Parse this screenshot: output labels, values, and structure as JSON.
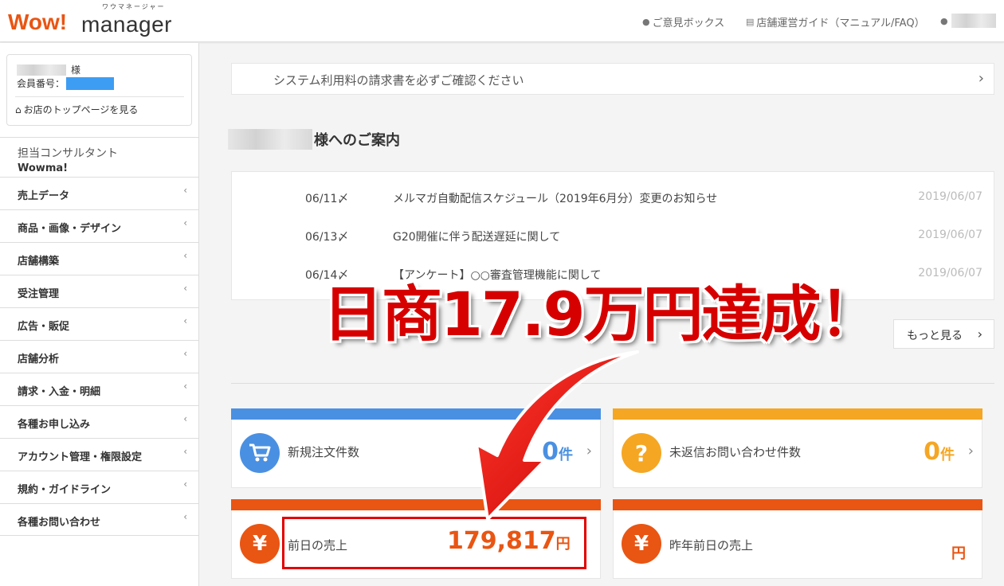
{
  "header": {
    "logo_main": "Wow!",
    "logo_sub": "manager",
    "logo_ruby": "ワウマネージャー",
    "links": [
      {
        "label": "ご意見ボックス",
        "icon": "speech-bubble-icon"
      },
      {
        "label": "店舗運営ガイド（マニュアル/FAQ）",
        "icon": "document-icon"
      }
    ],
    "user_icon": "user-icon"
  },
  "sidebar": {
    "name_suffix": "様",
    "member_id_label": "会員番号：",
    "top_page_link": "お店のトップページを見る",
    "consultant_label": "担当コンサルタント",
    "consultant_name": "Wowma!",
    "menu": [
      {
        "label": "売上データ"
      },
      {
        "label": "商品・画像・デザイン"
      },
      {
        "label": "店舗構築"
      },
      {
        "label": "受注管理"
      },
      {
        "label": "広告・販促"
      },
      {
        "label": "店舗分析"
      },
      {
        "label": "請求・入金・明細"
      },
      {
        "label": "各種お申し込み"
      },
      {
        "label": "アカウント管理・権限設定"
      },
      {
        "label": "規約・ガイドライン"
      },
      {
        "label": "各種お問い合わせ"
      }
    ],
    "chevron": "‹"
  },
  "main": {
    "notice": "システム利用料の請求書を必ずご確認ください",
    "section_title_suffix": "様へのご案内",
    "news": [
      {
        "date": "06/11〆",
        "title": "メルマガ自動配信スケジュール（2019年6月分）変更のお知らせ",
        "posted": "2019/06/07"
      },
      {
        "date": "06/13〆",
        "title": "G20開催に伴う配送遅延に関して",
        "posted": "2019/06/07"
      },
      {
        "date": "06/14〆",
        "title": "【アンケート】○○審査管理機能に関して",
        "posted": "2019/06/07"
      }
    ],
    "more_label": "もっと見る",
    "cards": [
      {
        "label": "新規注文件数",
        "value": "0",
        "unit": "件",
        "icon": "cart-icon",
        "color": "#4a90e2",
        "value_color": "#4a90e2"
      },
      {
        "label": "未返信お問い合わせ件数",
        "value": "0",
        "unit": "件",
        "icon": "question-icon",
        "color": "#f5a623",
        "value_color": "#f5a623"
      },
      {
        "label": "前日の売上",
        "value": "179,817",
        "unit": "円",
        "icon": "yen-icon",
        "color": "#e95513",
        "value_color": "#e95513"
      },
      {
        "label": "昨年前日の売上",
        "value": "",
        "unit": "円",
        "icon": "yen-icon",
        "color": "#e95513",
        "value_color": "#e95513"
      }
    ]
  },
  "overlay": {
    "headline": "日商17.9万円達成！"
  }
}
